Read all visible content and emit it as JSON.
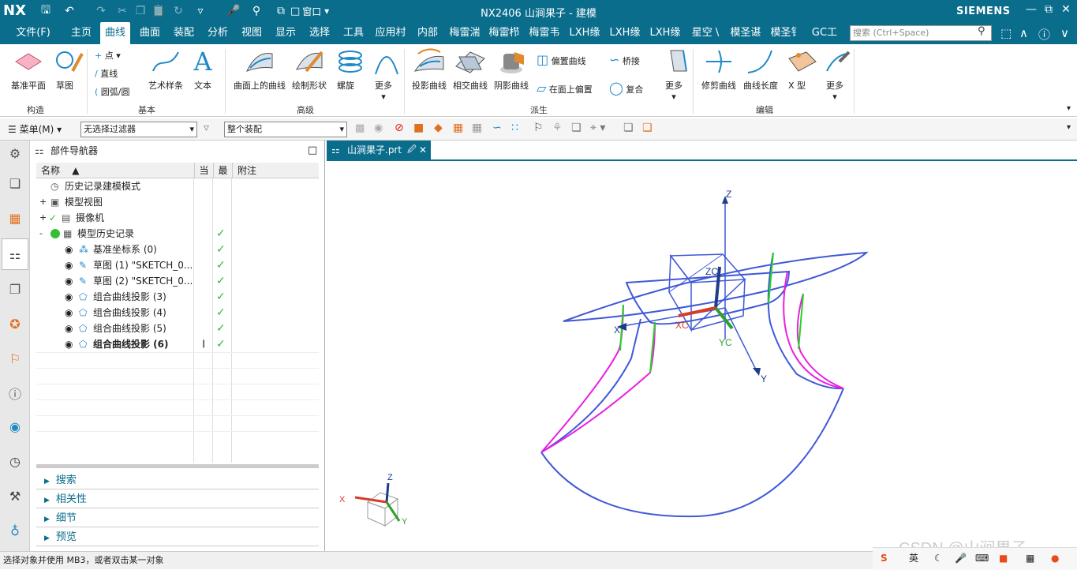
{
  "titlebar": {
    "logo": "NX",
    "title": "NX2406 山涧果子 - 建模",
    "brand": "SIEMENS",
    "window_menu": "窗口",
    "window_controls": [
      "min-icon",
      "restore-icon",
      "close-icon"
    ]
  },
  "menubar": {
    "tabs": [
      "文件(F)",
      "主页",
      "曲线",
      "曲面",
      "装配",
      "分析",
      "视图",
      "显示",
      "选择",
      "工具",
      "应用村",
      "内部",
      "梅雷湍",
      "梅雷栉",
      "梅雷韦",
      "LXH缘",
      "LXH缘",
      "LXH缘",
      "星空 \\",
      "模圣谌",
      "模圣钅",
      "GC工"
    ],
    "active_tab": "曲线",
    "search_placeholder": "搜索 (Ctrl+Space)"
  },
  "ribbon": {
    "groups": {
      "construct": "构造",
      "basic": "基本",
      "advanced": "高级",
      "derived": "派生",
      "edit": "编辑"
    },
    "items": {
      "datum_plane": "基准平面",
      "sketch": "草图",
      "point": "点",
      "line": "直线",
      "arc_circle": "圆弧/圆",
      "art_spline": "艺术样条",
      "text": "文本",
      "curve_on_surface": "曲面上的曲线",
      "draw_shape": "绘制形状",
      "helix": "螺旋",
      "more1": "更多",
      "project_curve": "投影曲线",
      "intersect_curve": "相交曲线",
      "shadow_curve": "阴影曲线",
      "offset_curve": "偏置曲线",
      "offset_in_face": "在面上偏置",
      "bridge": "桥接",
      "composite": "复合",
      "more2": "更多",
      "trim_curve": "修剪曲线",
      "curve_length": "曲线长度",
      "x_form": "X 型",
      "more3": "更多"
    }
  },
  "toolbar2": {
    "menu": "菜单(M)",
    "filter": "无选择过滤器",
    "assembly": "整个装配"
  },
  "navigator": {
    "title": "部件导航器",
    "columns": [
      "名称",
      "当",
      "最",
      "附注"
    ],
    "rows": [
      {
        "label": "历史记录建模模式",
        "check": false,
        "bold": false
      },
      {
        "label": "模型视图",
        "check": false,
        "bold": false
      },
      {
        "label": "摄像机",
        "check": false,
        "bold": false
      },
      {
        "label": "模型历史记录",
        "check": true,
        "bold": false
      },
      {
        "label": "基准坐标系 (0)",
        "check": true,
        "bold": false
      },
      {
        "label": "草图 (1) \"SKETCH_0...",
        "check": true,
        "bold": false
      },
      {
        "label": "草图 (2) \"SKETCH_0...",
        "check": true,
        "bold": false
      },
      {
        "label": "组合曲线投影 (3)",
        "check": true,
        "bold": false
      },
      {
        "label": "组合曲线投影 (4)",
        "check": true,
        "bold": false
      },
      {
        "label": "组合曲线投影 (5)",
        "check": true,
        "bold": false
      },
      {
        "label": "组合曲线投影 (6)",
        "check": true,
        "bold": true
      }
    ],
    "accordion": [
      "搜索",
      "相关性",
      "细节",
      "预览"
    ]
  },
  "graphics": {
    "tab_label": "山涧果子.prt",
    "axes": {
      "z": "Z",
      "x": "X",
      "y": "Y",
      "zc": "ZC",
      "xc": "XC",
      "yc": "YC"
    },
    "triad": {
      "z": "Z",
      "x": "X",
      "y": "Y"
    }
  },
  "status": {
    "text": "选择对象并使用 MB3，或者双击某一对象",
    "ime_lang": "英"
  },
  "watermark": "CSDN @山涧果子",
  "colors": {
    "accent": "#0a6d8c",
    "curve_blue": "#4059d8",
    "curve_green": "#21d421",
    "curve_magenta": "#ea1fe0"
  }
}
